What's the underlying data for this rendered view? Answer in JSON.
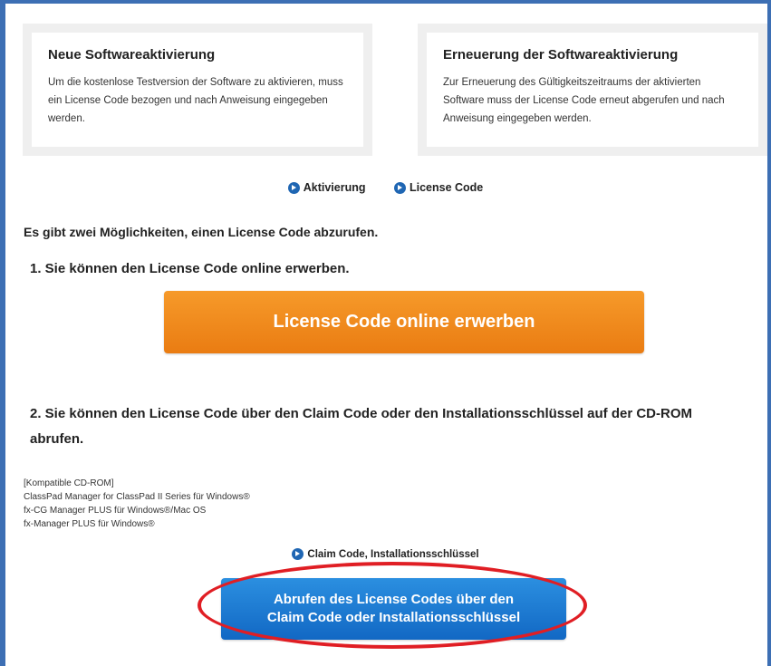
{
  "cards": {
    "new": {
      "title": "Neue Softwareaktivierung",
      "text": "Um die kostenlose Testversion der Software zu aktivieren, muss ein License Code bezogen und nach Anweisung eingegeben werden."
    },
    "renew": {
      "title": "Erneuerung der Softwareaktivierung",
      "text": "Zur Erneuerung des Gültigkeitszeitraums der aktivierten Software muss der License Code erneut abgerufen und nach Anweisung eingegeben werden."
    }
  },
  "links": {
    "activation": "Aktivierung",
    "license_code": "License Code"
  },
  "intro": "Es gibt zwei Möglichkeiten, einen License Code abzurufen.",
  "step1": {
    "text": "1. Sie können den License Code online erwerben.",
    "button": "License Code online erwerben"
  },
  "step2": {
    "text": "2. Sie können den License Code über den Claim Code oder den Installationsschlüssel auf der CD-ROM abrufen."
  },
  "compat": {
    "heading": "[Kompatible CD-ROM]",
    "items": [
      "ClassPad Manager for ClassPad II Series für Windows®",
      "fx-CG Manager PLUS für Windows®/Mac OS",
      "fx-Manager PLUS für Windows®"
    ]
  },
  "claim": {
    "link": "Claim Code, Installationsschlüssel",
    "button_line1": "Abrufen des License Codes über den",
    "button_line2": "Claim Code oder Installationsschlüssel"
  },
  "colors": {
    "accent_blue": "#1f66b3",
    "orange_button": "#f08a1c",
    "blue_button": "#1a7bd2",
    "highlight_red": "#e01e24",
    "frame": "#3d6fb4"
  }
}
